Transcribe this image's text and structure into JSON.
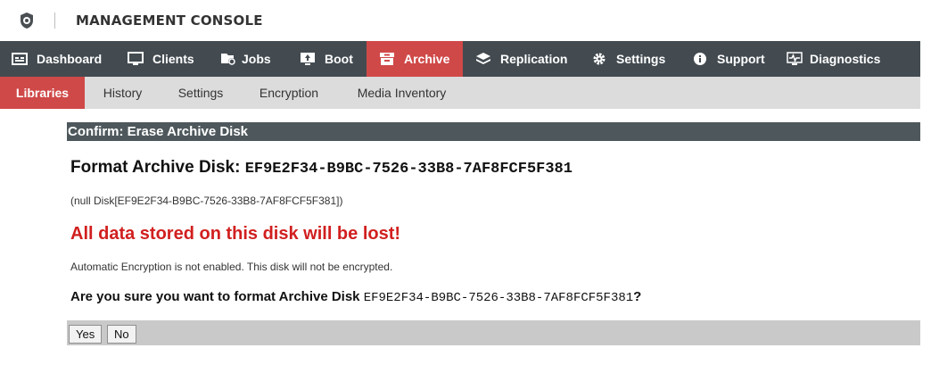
{
  "header": {
    "title": "MANAGEMENT CONSOLE"
  },
  "mainnav": {
    "items": [
      {
        "label": "Dashboard",
        "icon": "dashboard-icon",
        "active": false
      },
      {
        "label": "Clients",
        "icon": "monitor-icon",
        "active": false
      },
      {
        "label": "Jobs",
        "icon": "jobs-icon",
        "active": false
      },
      {
        "label": "Boot",
        "icon": "boot-icon",
        "active": false
      },
      {
        "label": "Archive",
        "icon": "archive-icon",
        "active": true
      },
      {
        "label": "Replication",
        "icon": "layers-icon",
        "active": false
      },
      {
        "label": "Settings",
        "icon": "gear-icon",
        "active": false
      },
      {
        "label": "Support",
        "icon": "info-icon",
        "active": false
      },
      {
        "label": "Diagnostics",
        "icon": "diagnostics-icon",
        "active": false
      }
    ]
  },
  "subnav": {
    "items": [
      {
        "label": "Libraries",
        "active": true
      },
      {
        "label": "History",
        "active": false
      },
      {
        "label": "Settings",
        "active": false
      },
      {
        "label": "Encryption",
        "active": false
      },
      {
        "label": "Media Inventory",
        "active": false
      }
    ]
  },
  "panel": {
    "title": "Confirm: Erase Archive Disk",
    "format_label": "Format Archive Disk:",
    "disk_id": "EF9E2F34-B9BC-7526-33B8-7AF8FCF5F381",
    "null_disk": "(null Disk[EF9E2F34-B9BC-7526-33B8-7AF8FCF5F381])",
    "warning": "All data stored on this disk will be lost!",
    "encryption_note": "Automatic Encryption is not enabled. This disk will not be encrypted.",
    "question_prefix": "Are you sure you want to format Archive Disk",
    "question_suffix": "?"
  },
  "actions": {
    "yes_label": "Yes",
    "no_label": "No"
  },
  "colors": {
    "nav_bg": "#434b51",
    "accent": "#cf4948",
    "subnav_bg": "#dcdcdc",
    "panel_title_bg": "#4e585c",
    "warning_red": "#d11f1f"
  }
}
